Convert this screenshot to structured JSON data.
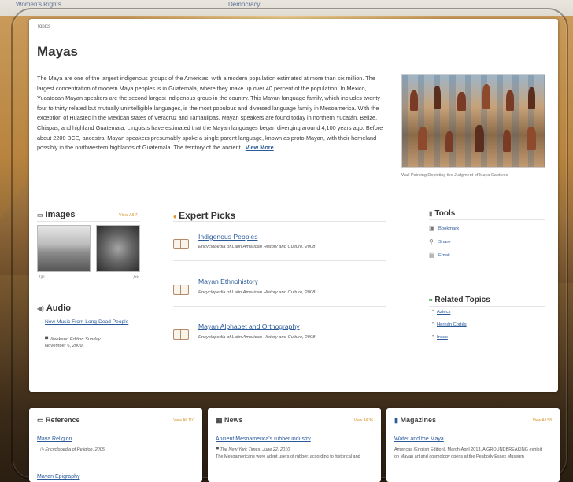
{
  "background": {
    "links": [
      "Women's Rights",
      "Democracy"
    ]
  },
  "page": {
    "breadcrumb": "Topics",
    "title": "Mayas",
    "intro": "The Maya are one of the largest indigenous groups of the Americas, with a modern population estimated at more than six million. The largest concentration of modern Maya peoples is in Guatemala, where they make up over 40 percent of the population. In Mexico, Yucatecan Mayan speakers are the second largest indigenous group in the country. This Mayan language family, which includes twenty-four to thirty related but mutually unintelligible languages, is the most populous and diversed language family in Mesoamerica. With the exception of Huastec in the Mexican states of Veracruz and Tamaulipas, Mayan speakers are found today in northern Yucatán, Belize, Chiapas, and highland Guatemala. Linguists have estimated that the Mayan languages began diverging around 4,100 years ago. Before about 2200 BCE, ancestral Mayan speakers presumably spoke a single parent language, known as proto-Mayan, with their homeland possibly in the northwestern highlands of Guatemala. The territory of the ancient...",
    "view_more": "View More",
    "image_caption": "Wall Painting Depicting the Judgment of Maya Captives"
  },
  "images": {
    "heading": "Images",
    "view_all": "View All 7",
    "thumbs": [
      {
        "label": "ƒjkl"
      },
      {
        "label": "ƒrkl"
      }
    ]
  },
  "audio": {
    "heading": "Audio",
    "item_title": "New Music From Long-Dead People",
    "item_source": "Weekend Edition Sunday",
    "item_date": "November 6, 2009"
  },
  "expert_picks": {
    "heading": "Expert Picks",
    "items": [
      {
        "title": "Indigenous Peoples",
        "source": "Encyclopedia of Latin American History and Culture, 2008"
      },
      {
        "title": "Mayan Ethnohistory",
        "source": "Encyclopedia of Latin American History and Culture, 2008"
      },
      {
        "title": "Mayan Alphabet and Orthography",
        "source": "Encyclopedia of Latin American History and Culture, 2008"
      }
    ]
  },
  "tools": {
    "heading": "Tools",
    "items": [
      "Bookmark",
      "Share",
      "Email"
    ]
  },
  "related": {
    "heading": "Related Topics",
    "items": [
      "Aztecs",
      "Hernán Cortés",
      "Incas"
    ]
  },
  "bottom": {
    "reference": {
      "heading": "Reference",
      "view_all": "View All 110",
      "link": "Maya Religion",
      "text": "Encyclopedia of Religion, 2005",
      "link2": "Mayan Epigraphy"
    },
    "news": {
      "heading": "News",
      "view_all": "View All 36",
      "link": "Ancient Mesoamerica's rubber industry",
      "source": "The New York Times, June 22, 2010",
      "text": "The Mesoamericans were adept users of rubber, according to historical and"
    },
    "magazines": {
      "heading": "Magazines",
      "view_all": "View All 58",
      "link": "Water and the Maya",
      "text": "Americas (English Edition), March-April 2013. A GROUNDBREAKING exhibit on Mayan art and cosmology opens at the Peabody Essex Museum"
    }
  }
}
